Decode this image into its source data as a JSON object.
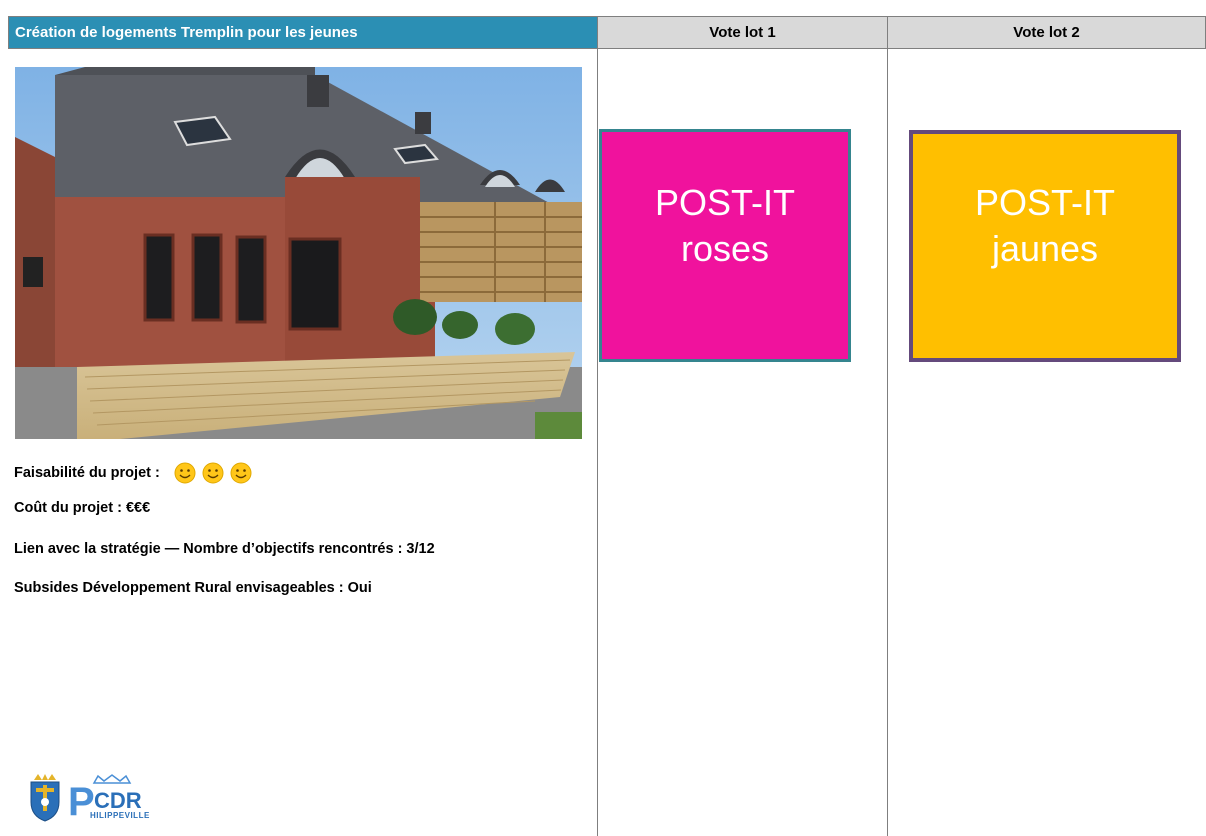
{
  "header": {
    "title": "Création de logements Tremplin pour les jeunes",
    "vote1": "Vote lot 1",
    "vote2": "Vote lot 2"
  },
  "project": {
    "feasibility_label": "Faisabilité du projet :",
    "feasibility_smileys": 3,
    "cost": "Coût du projet : €€€",
    "strategy": "Lien avec la stratégie — Nombre d’objectifs rencontrés : 3/12",
    "subsidies": "Subsides Développement Rural envisageables : Oui"
  },
  "postits": {
    "pink": {
      "line1": "POST-IT",
      "line2": "roses",
      "color": "#f0129d",
      "border": "#35858f"
    },
    "yellow": {
      "line1": "POST-IT",
      "line2": "jaunes",
      "color": "#ffbf00",
      "border": "#644a7c"
    }
  },
  "logo": {
    "letter": "P",
    "text": "CDR",
    "subtitle": "HILIPPEVILLE"
  },
  "colors": {
    "header_blue": "#2b8fb4",
    "header_grey": "#d9d9d9"
  }
}
